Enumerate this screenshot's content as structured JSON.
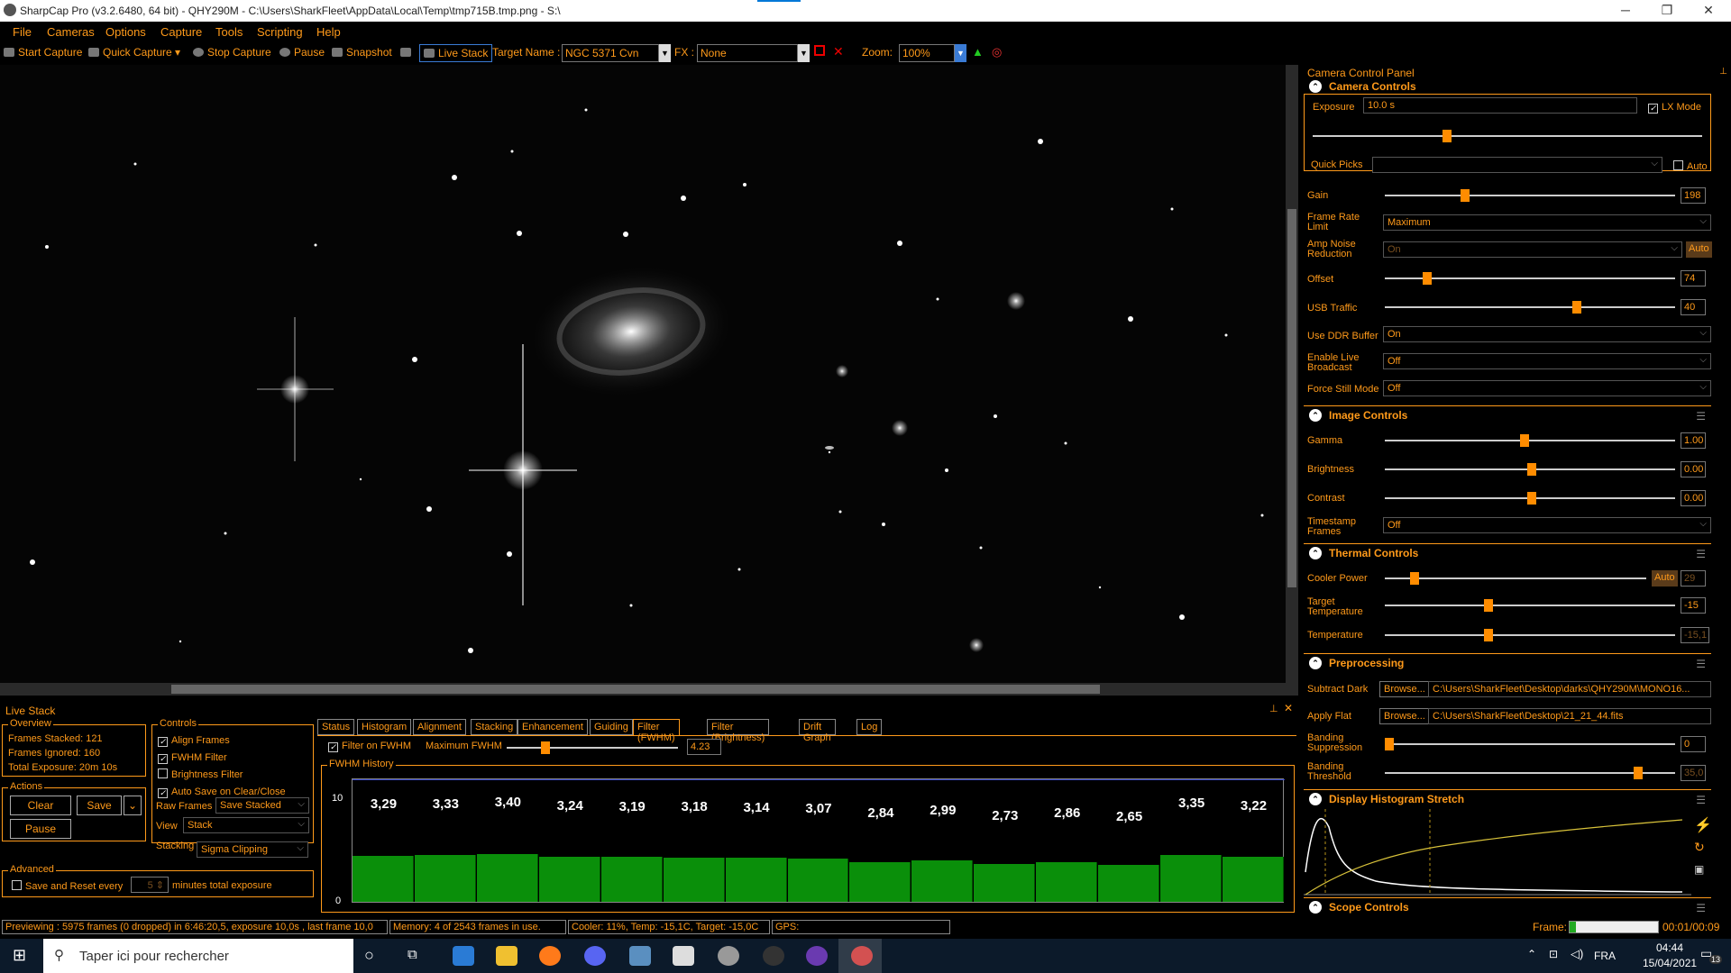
{
  "window": {
    "title": "SharpCap Pro (v3.2.6480, 64 bit) - QHY290M - C:\\Users\\SharkFleet\\AppData\\Local\\Temp\\tmp715B.tmp.png - S:\\",
    "minimize": "─",
    "restore": "❐",
    "close": "✕"
  },
  "menu": [
    "File",
    "Cameras",
    "Options",
    "Capture",
    "Tools",
    "Scripting",
    "Help"
  ],
  "toolbar": {
    "start_capture": "Start Capture",
    "quick_capture": "Quick Capture",
    "stop_capture": "Stop Capture",
    "pause": "Pause",
    "snapshot": "Snapshot",
    "live_stack": "Live Stack",
    "target_label": "Target Name :",
    "target_value": "NGC 5371  Cvn",
    "fx_label": "FX :",
    "fx_value": "None",
    "zoom_label": "Zoom:",
    "zoom_value": "100%"
  },
  "panel": {
    "title": "Camera Control Panel",
    "camera_controls": {
      "header": "Camera Controls",
      "exposure_label": "Exposure",
      "exposure_value": "10.0 s",
      "lx_mode": "LX Mode",
      "quick_picks": "Quick Picks",
      "auto": "Auto",
      "gain_label": "Gain",
      "gain_value": "198",
      "frame_rate_label": "Frame Rate Limit",
      "frame_rate_value": "Maximum",
      "amp_noise_label": "Amp Noise Reduction",
      "amp_noise_value": "On",
      "amp_auto": "Auto",
      "offset_label": "Offset",
      "offset_value": "74",
      "usb_label": "USB Traffic",
      "usb_value": "40",
      "ddr_label": "Use DDR Buffer",
      "ddr_value": "On",
      "broadcast_label": "Enable Live Broadcast",
      "broadcast_value": "Off",
      "force_still_label": "Force Still Mode",
      "force_still_value": "Off"
    },
    "image_controls": {
      "header": "Image Controls",
      "gamma_label": "Gamma",
      "gamma_value": "1.00",
      "brightness_label": "Brightness",
      "brightness_value": "0.00",
      "contrast_label": "Contrast",
      "contrast_value": "0.00",
      "timestamp_label": "Timestamp Frames",
      "timestamp_value": "Off"
    },
    "thermal_controls": {
      "header": "Thermal Controls",
      "cooler_label": "Cooler Power",
      "cooler_auto": "Auto",
      "cooler_value": "29",
      "target_temp_label": "Target Temperature",
      "target_temp_value": "-15",
      "temp_label": "Temperature",
      "temp_value": "-15,1"
    },
    "preprocessing": {
      "header": "Preprocessing",
      "dark_label": "Subtract Dark",
      "browse": "Browse...",
      "dark_path": "C:\\Users\\SharkFleet\\Desktop\\darks\\QHY290M\\MONO16...",
      "flat_label": "Apply Flat",
      "flat_path": "C:\\Users\\SharkFleet\\Desktop\\21_21_44.fits",
      "banding_supp_label": "Banding Suppression",
      "banding_supp_value": "0",
      "banding_thr_label": "Banding Threshold",
      "banding_thr_value": "35,0"
    },
    "histogram": {
      "header": "Display Histogram Stretch"
    },
    "scope": {
      "header": "Scope Controls"
    },
    "frame_label": "Frame:",
    "frame_time": "00:01/00:09"
  },
  "live_stack": {
    "title": "Live Stack",
    "overview": {
      "header": "Overview",
      "stacked": "Frames Stacked:  121",
      "ignored": "Frames Ignored:  160",
      "exposure": "Total Exposure:   20m 10s"
    },
    "actions": {
      "header": "Actions",
      "clear": "Clear",
      "save": "Save",
      "pause": "Pause"
    },
    "advanced": {
      "header": "Advanced",
      "save_reset": "Save and Reset every",
      "minutes_value": "5",
      "minutes_label": "minutes total exposure"
    },
    "controls": {
      "header": "Controls",
      "align": "Align Frames",
      "fwhm": "FWHM Filter",
      "brightness": "Brightness Filter",
      "autosave": "Auto Save on Clear/Close",
      "raw_label": "Raw Frames",
      "raw_value": "Save Stacked",
      "view_label": "View",
      "view_value": "Stack",
      "stacking_label": "Stacking",
      "stacking_value": "Sigma Clipping"
    },
    "tabs": [
      "Status",
      "Histogram",
      "Alignment",
      "Stacking",
      "Enhancement",
      "Guiding",
      "Filter (FWHM)",
      "Filter (Brightness)",
      "Drift Graph",
      "Log"
    ],
    "filter_on": "Filter on FWHM",
    "max_fwhm_label": "Maximum FWHM",
    "max_fwhm_value": "4.23",
    "history_title": "FWHM History",
    "axis_top": "10",
    "axis_bottom": "0"
  },
  "chart_data": {
    "type": "bar",
    "title": "FWHM History",
    "ylim": [
      0,
      10
    ],
    "values": [
      3.29,
      3.33,
      3.4,
      3.24,
      3.19,
      3.18,
      3.14,
      3.07,
      2.84,
      2.99,
      2.73,
      2.86,
      2.65,
      3.35,
      3.22
    ],
    "labels": [
      "3,29",
      "3,33",
      "3,40",
      "3,24",
      "3,19",
      "3,18",
      "3,14",
      "3,07",
      "2,84",
      "2,99",
      "2,73",
      "2,86",
      "2,65",
      "3,35",
      "3,22"
    ],
    "threshold": 4.23
  },
  "status": {
    "preview": "Previewing : 5975 frames (0 dropped) in 6:46:20,5, exposure 10,0s , last frame 10,0",
    "memory": "Memory: 4 of 2543 frames in use.",
    "cooler": "Cooler: 11%, Temp: -15,1C, Target: -15,0C",
    "gps": "GPS:"
  },
  "taskbar": {
    "search": "Taper ici pour rechercher",
    "lang": "FRA",
    "time": "04:44",
    "date": "15/04/2021",
    "notif": "13"
  },
  "colors": {
    "accent": "#ff9a1a",
    "bar": "#0a8f0a",
    "background": "#000000"
  }
}
